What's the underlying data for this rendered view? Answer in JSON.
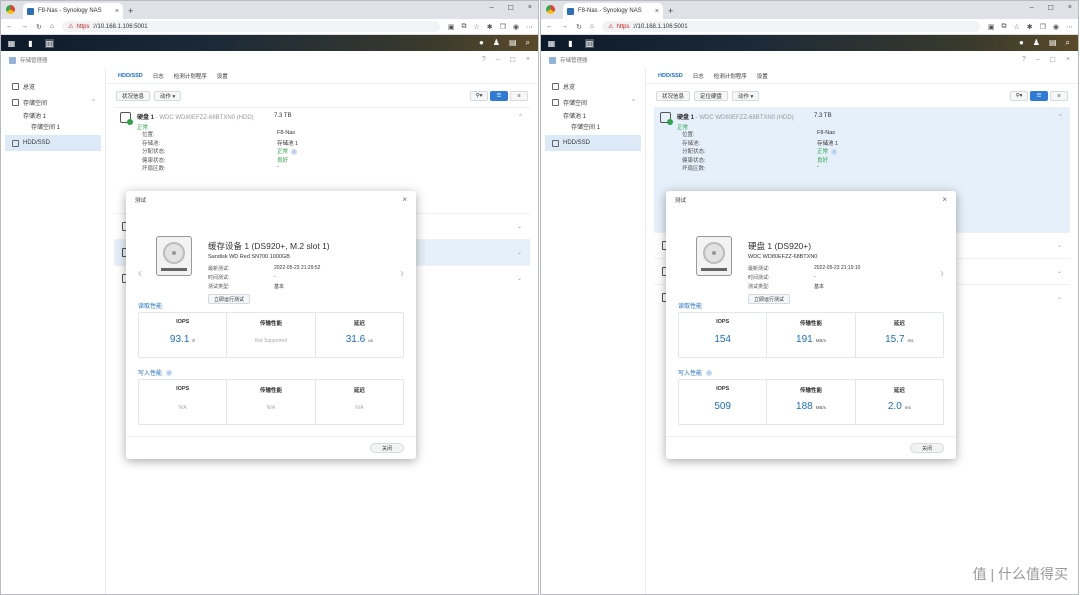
{
  "browser": {
    "tab_title": "F8-Nas - Synology NAS",
    "url_https": "https",
    "url_rest": "://10.168.1.106:5001",
    "new_tab": "+"
  },
  "window_title": "存储管理器",
  "sidebar": {
    "overview": "总览",
    "storage": "存储空间",
    "pool": "存储池 1",
    "volume": "存储空间 1",
    "hdd": "HDD/SSD"
  },
  "tabs": [
    "HDD/SSD",
    "日志",
    "检测计划程序",
    "设置"
  ],
  "toolbar_left": {
    "status": "状况信息",
    "action": "动作 ▾"
  },
  "toolbar_right": {
    "status": "状况信息",
    "locate": "定位硬盘",
    "action": "动作 ▾"
  },
  "disk": {
    "name": "硬盘 1",
    "model": " - WDC WD80EFZZ-68BTXN0 (HDD)",
    "status": "正常",
    "size": "7.3 TB",
    "props": [
      {
        "k": "位置:",
        "v": "F8-Nas"
      },
      {
        "k": "存储池:",
        "v": "存储池 1"
      },
      {
        "k": "分配状态:",
        "v": "正常"
      },
      {
        "k": "健康状态:",
        "v": "良好"
      },
      {
        "k": "坏扇区数:",
        "v": "-"
      }
    ]
  },
  "dialog_title": "测试",
  "close_label": "关闭",
  "read_label": "读取性能",
  "write_label": "写入性能",
  "col_labels": [
    "IOPS",
    "传输性能",
    "延迟"
  ],
  "meta_keys": [
    "最新测试:",
    "时间测试:",
    "测试类型:"
  ],
  "run_label": "立即运行测试",
  "left_dialog": {
    "title": "缓存设备 1 (DS920+, M.2 slot 1)",
    "model": "Sandisk WD Red SN700 1000GB",
    "meta_vals": [
      "2022-05-23 21:29:52",
      "-",
      "基本"
    ],
    "read": [
      {
        "v": "93.1",
        "u": "K"
      },
      {
        "v": "Not Supported",
        "u": ""
      },
      {
        "v": "31.6",
        "u": "us"
      }
    ],
    "write": [
      {
        "v": "N/A",
        "u": ""
      },
      {
        "v": "N/A",
        "u": ""
      },
      {
        "v": "N/A",
        "u": ""
      }
    ]
  },
  "right_dialog": {
    "title": "硬盘 1 (DS920+)",
    "model": "WDC WD80EFZZ-68BTXN0",
    "meta_vals": [
      "2022-05-23 21:19:10",
      "-",
      "基本"
    ],
    "read": [
      {
        "v": "154",
        "u": ""
      },
      {
        "v": "191",
        "u": "MB/s"
      },
      {
        "v": "15.7",
        "u": "ms"
      }
    ],
    "write": [
      {
        "v": "509",
        "u": ""
      },
      {
        "v": "188",
        "u": "MB/s"
      },
      {
        "v": "2.0",
        "u": "ms"
      }
    ]
  },
  "watermark": "值 | 什么值得买",
  "colors": {
    "accent": "#1b6fc4",
    "ok": "#2aa54c",
    "selected": "#e6f0fa"
  }
}
